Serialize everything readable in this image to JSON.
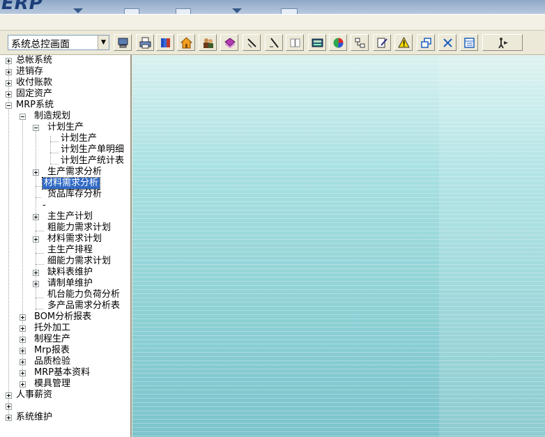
{
  "app": {
    "logo_text": "ERP"
  },
  "toolbar": {
    "module_select": {
      "value": "系统总控画面"
    },
    "buttons": [
      {
        "name": "switch-user-icon"
      },
      {
        "name": "printer-icon"
      },
      {
        "name": "books-icon"
      },
      {
        "name": "home-icon"
      },
      {
        "name": "users-icon"
      },
      {
        "name": "notebook-icon"
      },
      {
        "name": "pencil-icon"
      },
      {
        "name": "pen-icon"
      },
      {
        "name": "open-book-icon"
      },
      {
        "name": "calculator-icon"
      },
      {
        "name": "chart-icon"
      },
      {
        "name": "network-icon"
      },
      {
        "name": "edit-document-icon"
      },
      {
        "name": "warning-icon"
      },
      {
        "name": "cascade-windows-icon"
      },
      {
        "name": "close-icon"
      },
      {
        "name": "window-list-icon"
      },
      {
        "name": "exit-icon"
      }
    ]
  },
  "tree": {
    "nodes": [
      {
        "label": "总帐系统"
      },
      {
        "label": "进销存"
      },
      {
        "label": "收付账款"
      },
      {
        "label": "固定资产"
      },
      {
        "label": "MRP系统"
      },
      {
        "label": "制造规划"
      },
      {
        "label": "计划生产"
      },
      {
        "label": "计划生产"
      },
      {
        "label": "计划生产单明细"
      },
      {
        "label": "计划生产统计表"
      },
      {
        "label": "生产需求分析"
      },
      {
        "label": "材料需求分析"
      },
      {
        "label": "货品库存分析"
      },
      {
        "label": "-"
      },
      {
        "label": "主生产计划"
      },
      {
        "label": "粗能力需求计划"
      },
      {
        "label": "材料需求计划"
      },
      {
        "label": "主生产排程"
      },
      {
        "label": "细能力需求计划"
      },
      {
        "label": "缺料表维护"
      },
      {
        "label": "请制单维护"
      },
      {
        "label": "机台能力负荷分析"
      },
      {
        "label": "多产品需求分析表"
      },
      {
        "label": "BOM分析报表"
      },
      {
        "label": "托外加工"
      },
      {
        "label": "制程生产"
      },
      {
        "label": "Mrp报表"
      },
      {
        "label": "品质检验"
      },
      {
        "label": "MRP基本资料"
      },
      {
        "label": "模具管理"
      },
      {
        "label": "人事薪资"
      },
      {
        "label": ""
      },
      {
        "label": "系统维护"
      }
    ]
  },
  "colors": {
    "selection": "#316ac5",
    "content_top": "#d9f1f0",
    "content_bottom": "#7cc4cb"
  }
}
